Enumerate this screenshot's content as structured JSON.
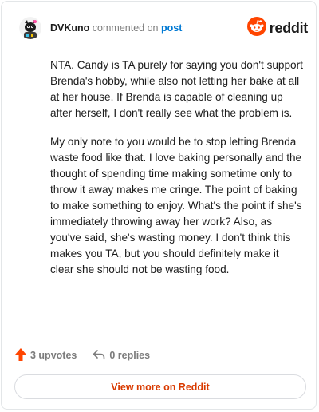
{
  "header": {
    "username": "DVKuno",
    "action": "commented on",
    "post_link": "post",
    "brand": "reddit"
  },
  "comment": {
    "paragraphs": [
      "NTA. Candy is TA purely for saying you don't support Brenda's hobby, while also not letting her bake at all at her house. If Brenda is capable of cleaning up after herself, I don't really see what the problem is.",
      "My only note to you would be to stop letting Brenda waste food like that. I love baking personally and the thought of spending time making sometime only to throw it away makes me cringe. The point of baking to make something to enjoy. What's the point if she's immediately throwing away her work? Also, as you've said, she's wasting money. I don't think this makes you TA, but you should definitely make it clear she should not be wasting food."
    ]
  },
  "actions": {
    "upvotes": "3 upvotes",
    "replies": "0 replies"
  },
  "footer": {
    "view_more": "View more on Reddit"
  },
  "colors": {
    "brand_orange": "#ff4500",
    "link_blue": "#0079d3",
    "cta_text": "#d93a00",
    "muted_text": "#7c7c7c"
  },
  "icons": {
    "avatar": "snoo-avatar",
    "brand": "reddit-logo-icon",
    "upvote": "upvote-arrow-icon",
    "reply": "reply-arrow-icon"
  }
}
